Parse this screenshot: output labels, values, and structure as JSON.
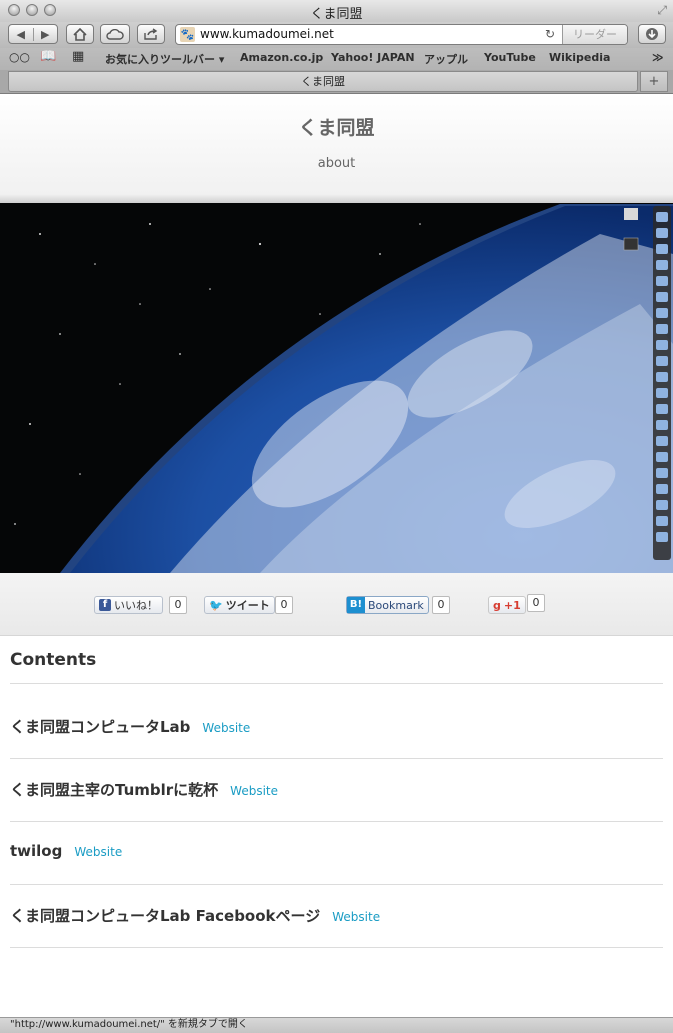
{
  "window": {
    "title": "くま同盟"
  },
  "toolbar": {
    "url": "www.kumadoumei.net",
    "reader_label": "リーダー"
  },
  "bookmarks": {
    "folder": "お気に入りツールバー",
    "items": [
      "Amazon.co.jp",
      "Yahoo! JAPAN",
      "アップル",
      "YouTube",
      "Wikipedia"
    ],
    "more": "≫"
  },
  "tab": {
    "title": "くま同盟"
  },
  "site": {
    "title": "くま同盟",
    "about": "about"
  },
  "share": {
    "facebook": {
      "label": "いいね！",
      "count": "0"
    },
    "twitter": {
      "label": "ツイート",
      "count": "0"
    },
    "hatena": {
      "label": "Bookmark",
      "count": "0"
    },
    "google": {
      "label": "+1",
      "count": "0"
    }
  },
  "contents": {
    "heading": "Contents",
    "items": [
      {
        "title": "くま同盟コンピュータLab",
        "link": "Website"
      },
      {
        "title": "くま同盟主宰のTumblrに乾杯",
        "link": "Website"
      },
      {
        "title": "twilog",
        "link": "Website"
      },
      {
        "title": "くま同盟コンピュータLab Facebookページ",
        "link": "Website"
      }
    ]
  },
  "status": {
    "text": "\"http://www.kumadoumei.net/\" を新規タブで開く"
  },
  "colors": {
    "link": "#1a9cc4",
    "title": "#666666",
    "ocean": "#1a4fa8"
  }
}
